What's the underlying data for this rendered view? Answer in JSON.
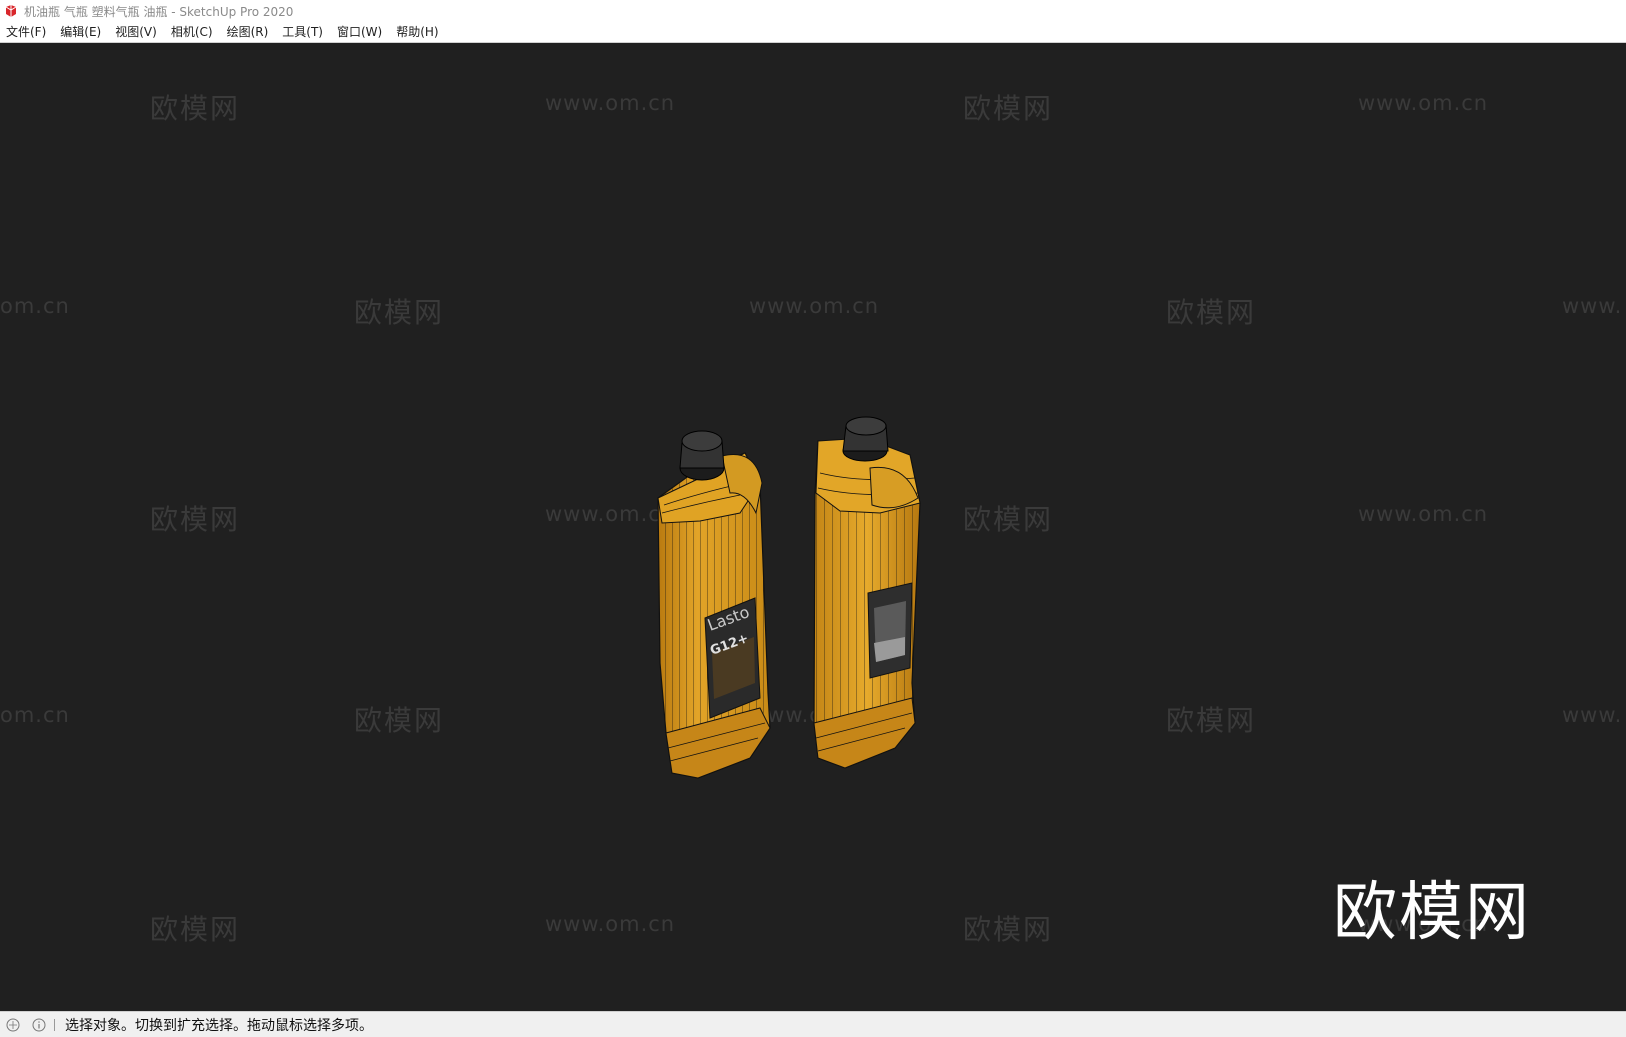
{
  "window": {
    "title": "机油瓶 气瓶 塑料气瓶 油瓶 - SketchUp Pro 2020"
  },
  "menu": {
    "items": [
      {
        "label": "文件(F)"
      },
      {
        "label": "编辑(E)"
      },
      {
        "label": "视图(V)"
      },
      {
        "label": "相机(C)"
      },
      {
        "label": "绘图(R)"
      },
      {
        "label": "工具(T)"
      },
      {
        "label": "窗口(W)"
      },
      {
        "label": "帮助(H)"
      }
    ]
  },
  "watermark": {
    "cn": "欧模网",
    "url": "www.om.cn",
    "url_partial_left": "om.cn",
    "url_partial_right": "www.",
    "big": "欧模网"
  },
  "model": {
    "label_brand": "Lasto",
    "label_grade": "G12+",
    "colors": {
      "bottle": "#d89a1c",
      "bottle_dark": "#a8700e",
      "cap": "#2e2e2e",
      "wire": "#111111"
    }
  },
  "status": {
    "message": "选择对象。切换到扩充选择。拖动鼠标选择多项。"
  }
}
